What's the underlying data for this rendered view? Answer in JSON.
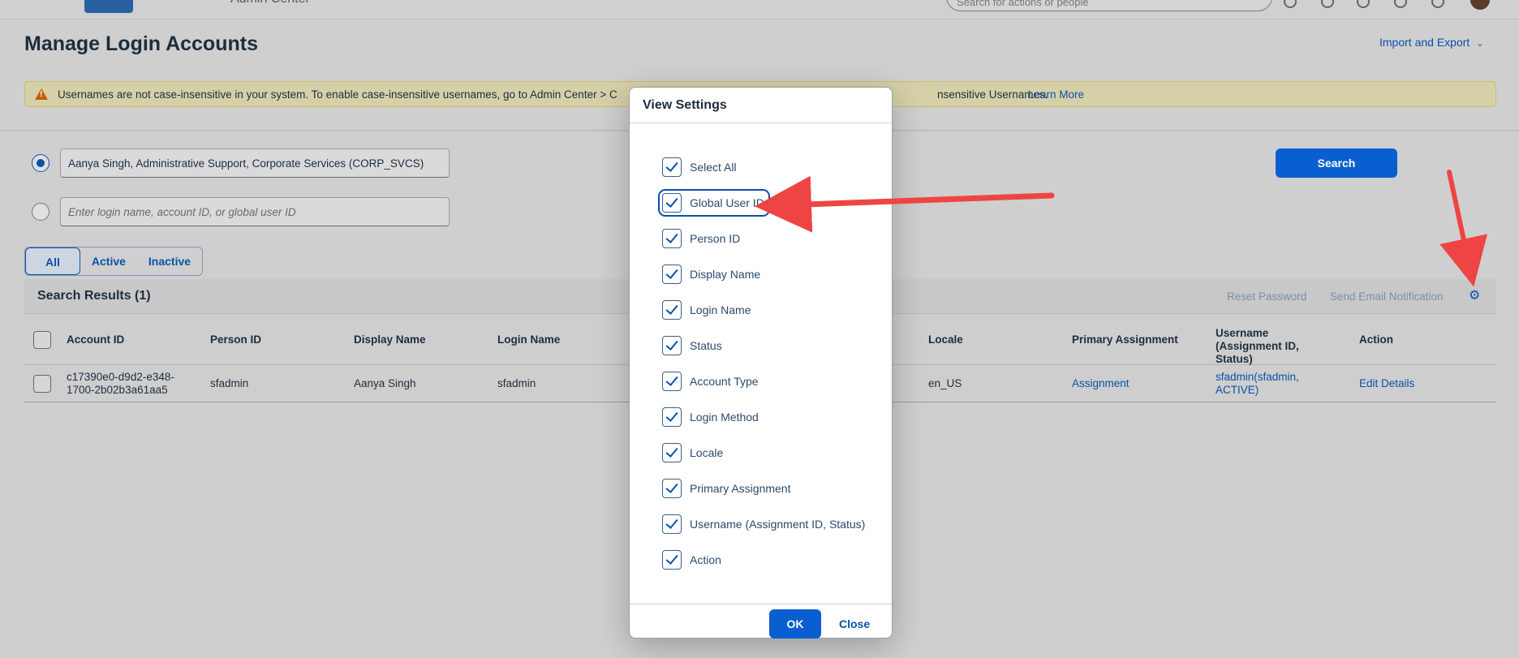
{
  "shell": {
    "title": "Admin Center",
    "search_placeholder": "Search for actions or people"
  },
  "header": {
    "title": "Manage Login Accounts",
    "import_export": "Import and Export"
  },
  "warning": {
    "text_left": "Usernames are not case-insensitive in your system. To enable case-insensitive usernames, go to Admin Center > C",
    "text_right": "nsensitive Usernames.",
    "link": "Learn More"
  },
  "search": {
    "selected_value": "Aanya Singh, Administrative Support, Corporate Services (CORP_SVCS)",
    "placeholder": "Enter login name, account ID, or global user ID",
    "button": "Search"
  },
  "filters": [
    "All",
    "Active",
    "Inactive"
  ],
  "results": {
    "title": "Search Results (1)",
    "reset_password": "Reset Password",
    "send_email": "Send Email Notification",
    "columns": [
      "Account ID",
      "Person ID",
      "Display Name",
      "Login Name",
      "Locale",
      "Primary Assignment",
      "Username (Assignment ID, Status)",
      "Action"
    ],
    "row": {
      "account_id": "c17390e0-d9d2-e348-1700-2b02b3a61aa5",
      "person_id": "sfadmin",
      "display_name": "Aanya Singh",
      "login_name": "sfadmin",
      "locale": "en_US",
      "primary_assignment": "Assignment",
      "username": "sfadmin(sfadmin, ACTIVE)",
      "action": "Edit Details"
    }
  },
  "modal": {
    "title": "View Settings",
    "options": [
      "Select All",
      "Global User ID",
      "Person ID",
      "Display Name",
      "Login Name",
      "Status",
      "Account Type",
      "Login Method",
      "Locale",
      "Primary Assignment",
      "Username (Assignment ID, Status)",
      "Action"
    ],
    "ok": "OK",
    "close": "Close"
  },
  "colors": {
    "accent": "#0a5fd0",
    "arrow": "#ef4444",
    "warning_bg": "#d6d0a8"
  }
}
